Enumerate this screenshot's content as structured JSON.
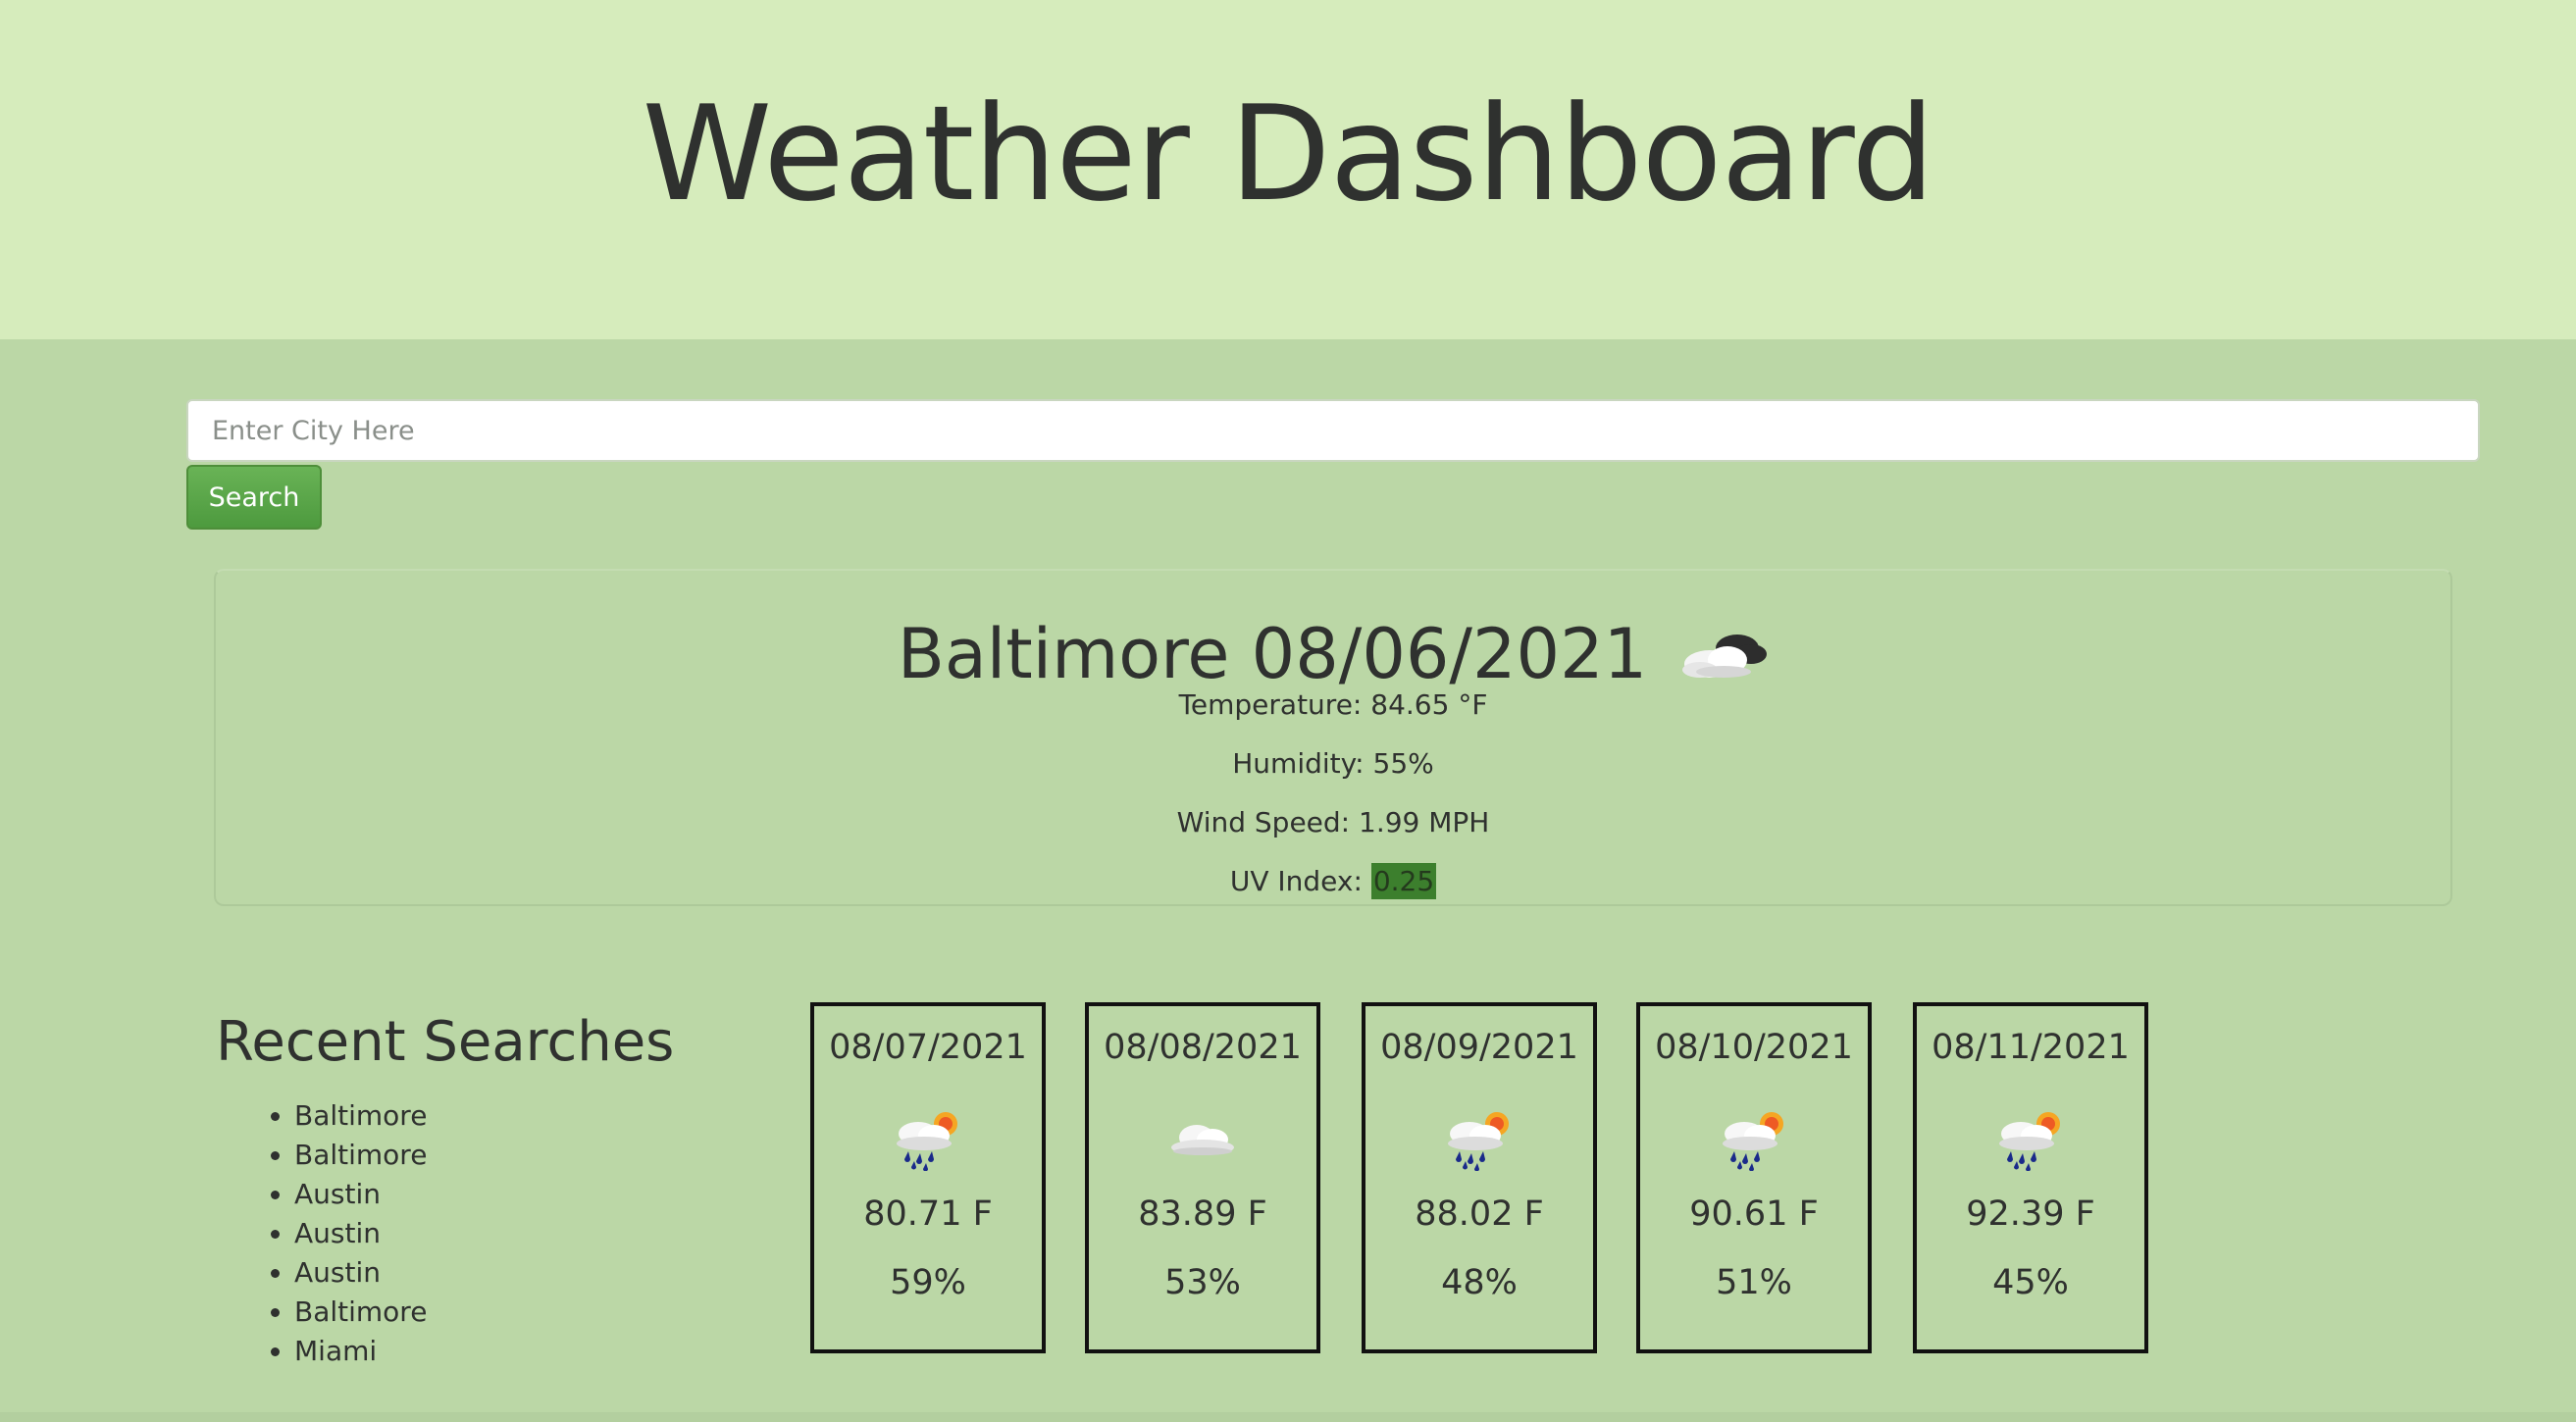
{
  "header": {
    "title": "Weather Dashboard"
  },
  "search": {
    "placeholder": "Enter City Here",
    "value": "",
    "button_label": "Search"
  },
  "current": {
    "title": "Baltimore 08/06/2021",
    "icon": "cloudy-icon",
    "temperature": "Temperature: 84.65 °F",
    "humidity": "Humidity: 55%",
    "wind": "Wind Speed: 1.99 MPH",
    "uv_label": "UV Index:",
    "uv_value": "0.25",
    "uv_color": "#3c7f2d"
  },
  "recent": {
    "title": "Recent Searches",
    "items": [
      "Baltimore",
      "Baltimore",
      "Austin",
      "Austin",
      "Austin",
      "Baltimore",
      "Miami"
    ]
  },
  "forecast": [
    {
      "date": "08/07/2021",
      "icon": "rain-sun-icon",
      "temp": "80.71 F",
      "humidity": "59%"
    },
    {
      "date": "08/08/2021",
      "icon": "cloud-icon",
      "temp": "83.89 F",
      "humidity": "53%"
    },
    {
      "date": "08/09/2021",
      "icon": "rain-sun-icon",
      "temp": "88.02 F",
      "humidity": "48%"
    },
    {
      "date": "08/10/2021",
      "icon": "rain-sun-icon",
      "temp": "90.61 F",
      "humidity": "51%"
    },
    {
      "date": "08/11/2021",
      "icon": "rain-sun-icon",
      "temp": "92.39 F",
      "humidity": "45%"
    }
  ],
  "colors": {
    "header_bg": "#d6ecbc",
    "page_bg": "#bbd7a6",
    "button": "#5aa548"
  }
}
